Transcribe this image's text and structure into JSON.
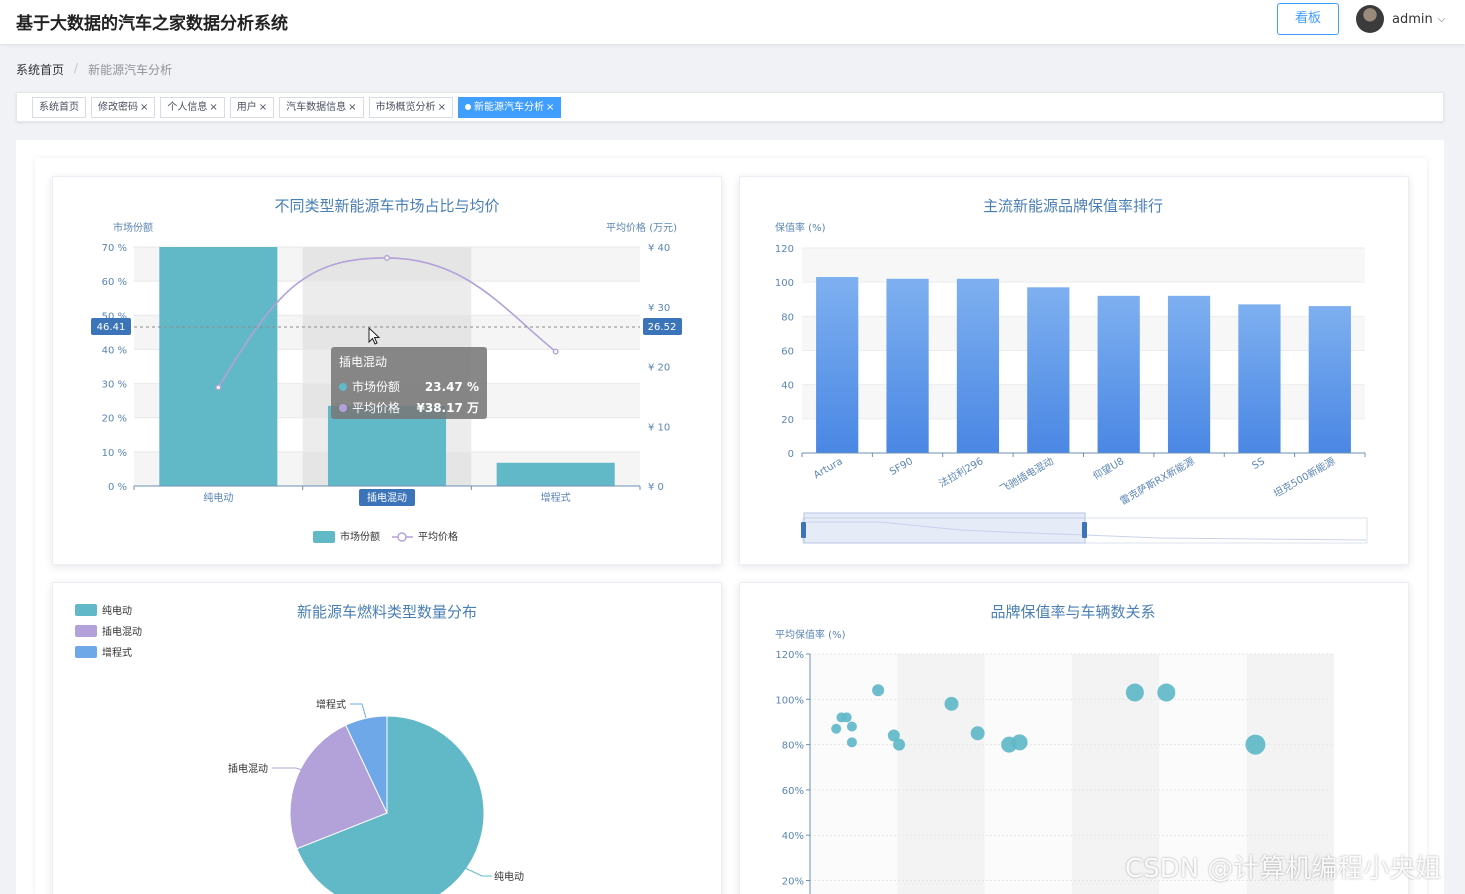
{
  "header": {
    "title": "基于大数据的汽车之家数据分析系统",
    "kanban_label": "看板",
    "username": "admin"
  },
  "breadcrumb": {
    "home": "系统首页",
    "separator": "/",
    "current": "新能源汽车分析"
  },
  "tags": [
    {
      "label": "系统首页",
      "closable": false,
      "active": false
    },
    {
      "label": "修改密码",
      "closable": true,
      "active": false
    },
    {
      "label": "个人信息",
      "closable": true,
      "active": false
    },
    {
      "label": "用户",
      "closable": true,
      "active": false
    },
    {
      "label": "汽车数据信息",
      "closable": true,
      "active": false
    },
    {
      "label": "市场概览分析",
      "closable": true,
      "active": false
    },
    {
      "label": "新能源汽车分析",
      "closable": true,
      "active": true
    }
  ],
  "close_glyph": "×",
  "watermark": "CSDN @计算机编程小央姐",
  "tooltip": {
    "title": "插电混动",
    "rows": [
      {
        "name": "市场份额",
        "value": "23.47 %",
        "color": "#61b9c8"
      },
      {
        "name": "平均价格",
        "value": "¥38.17 万",
        "color": "#b3a1d9"
      }
    ]
  },
  "chart_data": [
    {
      "type": "bar",
      "title": "不同类型新能源车市场占比与均价",
      "categories": [
        "纯电动",
        "插电混动",
        "增程式"
      ],
      "highlighted_category": "插电混动",
      "y_left_label": "市场份额",
      "y_right_label": "平均价格 (万元)",
      "y_left_ticks": [
        "0 %",
        "10 %",
        "20 %",
        "30 %",
        "40 %",
        "50 %",
        "60 %",
        "70 %"
      ],
      "y_right_ticks": [
        "¥ 0",
        "¥ 10",
        "¥ 20",
        "¥ 30",
        "¥ 40"
      ],
      "ylim_left": [
        0,
        70
      ],
      "ylim_right": [
        0,
        40
      ],
      "cursor_marker_left": "46.41",
      "cursor_marker_right": "26.52",
      "series": [
        {
          "name": "市场份额",
          "type": "bar",
          "values": [
            70,
            23.47,
            6.8
          ],
          "color": "#61b9c8"
        },
        {
          "name": "平均价格",
          "type": "line",
          "values": [
            16.5,
            38.17,
            22.5
          ],
          "color": "#b3a1d9"
        }
      ],
      "legend": [
        "市场份额",
        "平均价格"
      ]
    },
    {
      "type": "bar",
      "title": "主流新能源品牌保值率排行",
      "ylabel": "保值率 (%)",
      "ylim": [
        0,
        120
      ],
      "y_ticks": [
        "0",
        "20",
        "40",
        "60",
        "80",
        "100",
        "120"
      ],
      "categories": [
        "Artura",
        "SF90",
        "法拉利296",
        "飞驰插电混动",
        "仰望U8",
        "雷克萨斯RX新能源",
        "SS",
        "坦克500新能源"
      ],
      "values": [
        103,
        102,
        102,
        97,
        92,
        92,
        87,
        86
      ],
      "color_top": "#7eb0f0",
      "color_bottom": "#4a87e4"
    },
    {
      "type": "pie",
      "title": "新能源车燃料类型数量分布",
      "slices": [
        {
          "name": "纯电动",
          "value": 69,
          "color": "#61b9c8"
        },
        {
          "name": "插电混动",
          "value": 24,
          "color": "#b3a1d9"
        },
        {
          "name": "增程式",
          "value": 7,
          "color": "#6fa8e8"
        }
      ],
      "legend": [
        "纯电动",
        "插电混动",
        "增程式"
      ]
    },
    {
      "type": "scatter",
      "title": "品牌保值率与车辆数关系",
      "ylabel": "平均保值率 (%)",
      "ylim": [
        20,
        120
      ],
      "y_ticks": [
        "20%",
        "40%",
        "60%",
        "80%",
        "100%",
        "120%"
      ],
      "xlim": [
        0,
        100
      ],
      "points": [
        {
          "x": 5,
          "y": 87,
          "size": 5
        },
        {
          "x": 6,
          "y": 92,
          "size": 5
        },
        {
          "x": 7,
          "y": 92,
          "size": 5
        },
        {
          "x": 8,
          "y": 81,
          "size": 5
        },
        {
          "x": 8,
          "y": 88,
          "size": 5
        },
        {
          "x": 13,
          "y": 104,
          "size": 6
        },
        {
          "x": 16,
          "y": 84,
          "size": 6
        },
        {
          "x": 17,
          "y": 80,
          "size": 6
        },
        {
          "x": 27,
          "y": 98,
          "size": 7
        },
        {
          "x": 32,
          "y": 85,
          "size": 7
        },
        {
          "x": 38,
          "y": 80,
          "size": 8
        },
        {
          "x": 40,
          "y": 81,
          "size": 8
        },
        {
          "x": 62,
          "y": 103,
          "size": 9
        },
        {
          "x": 68,
          "y": 103,
          "size": 9
        },
        {
          "x": 85,
          "y": 80,
          "size": 10
        }
      ],
      "color": "#61b9c8"
    }
  ]
}
